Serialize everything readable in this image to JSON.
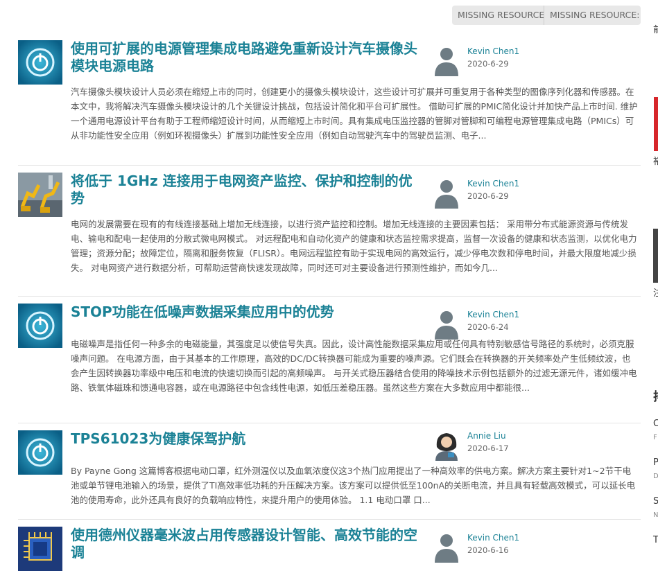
{
  "tabs": [
    {
      "label": "MISSING RESOURCE: M"
    },
    {
      "label": "MISSING RESOURCE: S"
    }
  ],
  "posts": [
    {
      "title": "使用可扩展的电源管理集成电路避免重新设计汽车摄像头模块电源电路",
      "thumb_icon": "power-icon",
      "author": "Kevin Chen1",
      "date": "2020-6-29",
      "excerpt": "汽车摄像头模块设计人员必须在缩短上市的同时，创建更小的摄像头模块设计，这些设计可扩展并可重复用于各种类型的图像序列化器和传感器。在本文中，我将解决汽车摄像头模块设计的几个关键设计挑战，包括设计简化和平台可扩展性。 借助可扩展的PMIC简化设计并加快产品上市时间. 维护一个通用电源设计平台有助于工程师缩短设计时间，从而缩短上市时间。具有集成电压监控器的管脚对管脚和可编程电源管理集成电路（PMICs）可从非功能性安全应用（例如环视摄像头）扩展到功能性安全应用（例如自动驾驶汽车中的驾驶员监测、电子..."
    },
    {
      "title": "将低于 1GHz 连接用于电网资产监控、保护和控制的优势",
      "thumb_icon": "robot-factory-photo",
      "author": "Kevin Chen1",
      "date": "2020-6-29",
      "excerpt": "电网的发展需要在现有的有线连接基础上增加无线连接，以进行资产监控和控制。增加无线连接的主要因素包括： 采用带分布式能源资源与传统发电、输电和配电一起使用的分散式微电网模式。 对远程配电和自动化资产的健康和状态监控需求提高，监督一次设备的健康和状态监测，以优化电力管理；资源分配；故障定位，隔离和服务恢复（FLISR）。电网远程监控有助于实现电网的高效运行，减少停电次数和停电时间，并最大限度地减少损失。 对电网资产进行数据分析，可帮助运营商快速发现故障，同时还可对主要设备进行预测性维护，而如今几..."
    },
    {
      "title": "STOP功能在低噪声数据采集应用中的优势",
      "thumb_icon": "power-icon",
      "author": "Kevin Chen1",
      "date": "2020-6-24",
      "excerpt": "电磁噪声是指任何一种多余的电磁能量，其强度足以使信号失真。因此，设计高性能数据采集应用或任何具有特别敏感信号路径的系统时，必须克服噪声问题。 在电源方面，由于其基本的工作原理，高效的DC/DC转换器可能成为重要的噪声源。它们既会在转换器的开关频率处产生低频纹波，也会产生因转换器功率级中电压和电流的快速切换而引起的高频噪声。 与开关式稳压器结合使用的降噪技术示例包括额外的过滤无源元件，诸如缓冲电路、铁氧体磁珠和馈通电容器，或在电源路径中包含线性电源，如低压差稳压器。虽然这些方案在大多数应用中都能很..."
    },
    {
      "title": "TPS61023为健康保驾护航",
      "thumb_icon": "power-icon",
      "author": "Annie Liu",
      "date": "2020-6-17",
      "excerpt": "By Payne Gong 这篇博客根据电动口罩，红外测温仪以及血氧浓度仪这3个热门应用提出了一种高效率的供电方案。解决方案主要针对1~2节干电池或单节锂电池输入的场景，提供了TI高效率低功耗的升压解决方案。该方案可以提供低至100nA的关断电流，并且具有轻载高效模式，可以延长电池的使用寿命，此外还具有良好的负载响应特性，来提升用户的使用体验。 1.1 电动口罩 口..."
    },
    {
      "title": "使用德州仪器毫米波占用传感器设计智能、高效节能的空调",
      "thumb_icon": "chip-photo",
      "author": "Kevin Chen1",
      "date": "2020-6-16",
      "excerpt": ""
    }
  ],
  "sidebar_glyphs": [
    "前",
    "裕",
    "注",
    "排",
    "C",
    "F",
    "P",
    "D",
    "S",
    "N",
    "T"
  ],
  "colors": {
    "accent": "#1b8296",
    "text": "#555555",
    "tab_bg": "#e8e8e8",
    "red_strip": "#d7262b"
  }
}
